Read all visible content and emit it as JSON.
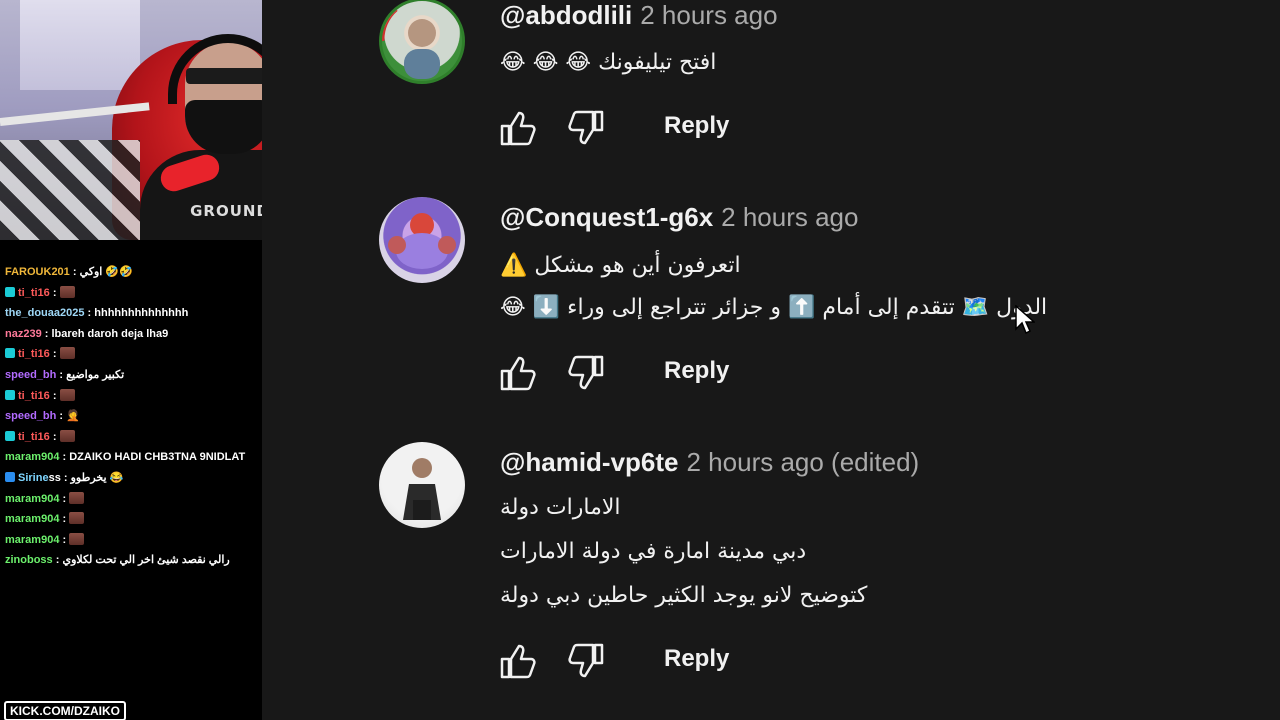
{
  "chat": {
    "messages": [
      {
        "user": "FAROUK201",
        "color": "#f0b73a",
        "sep": " : ",
        "text": "اوكي 🤣🤣",
        "badge": "",
        "emote": false
      },
      {
        "user": "ti_ti16",
        "color": "#ff5a5a",
        "sep": " : ",
        "text": "",
        "badge": "cyan",
        "emote": true
      },
      {
        "user": "the_douaa2025",
        "color": "#9fd8f7",
        "sep": " : ",
        "text": "hhhhhhhhhhhhhh",
        "badge": "",
        "emote": false
      },
      {
        "user": "naz239",
        "color": "#ff7a9a",
        "sep": " : ",
        "text": "lbareh daroh deja lha9",
        "badge": "",
        "emote": false
      },
      {
        "user": "ti_ti16",
        "color": "#ff5a5a",
        "sep": " : ",
        "text": "",
        "badge": "cyan",
        "emote": true
      },
      {
        "user": "speed_bh",
        "color": "#b26bff",
        "sep": " : ",
        "text": "تكبير مواضيع",
        "badge": "",
        "emote": false
      },
      {
        "user": "ti_ti16",
        "color": "#ff5a5a",
        "sep": " : ",
        "text": "",
        "badge": "cyan",
        "emote": true
      },
      {
        "user": "speed_bh",
        "color": "#b26bff",
        "sep": " : ",
        "text": "🤦",
        "badge": "",
        "emote": false
      },
      {
        "user": "ti_ti16",
        "color": "#ff5a5a",
        "sep": " : ",
        "text": "",
        "badge": "cyan",
        "emote": true
      },
      {
        "user": "maram904",
        "color": "#6cf06c",
        "sep": " : ",
        "text": "DZAIKO HADI CHB3TNA 9NIDLAT",
        "badge": "",
        "emote": false
      },
      {
        "user": "Sirine",
        "color": "#7fd6ff",
        "sep": "ss : ",
        "text": "يخرطوو 😂",
        "badge": "blue",
        "emote": false
      },
      {
        "user": "maram904",
        "color": "#6cf06c",
        "sep": " : ",
        "text": "",
        "badge": "",
        "emote": true
      },
      {
        "user": "maram904",
        "color": "#6cf06c",
        "sep": " : ",
        "text": "",
        "badge": "",
        "emote": true
      },
      {
        "user": "maram904",
        "color": "#6cf06c",
        "sep": " : ",
        "text": "",
        "badge": "",
        "emote": true
      },
      {
        "user": "zinoboss",
        "color": "#6cf06c",
        "sep": " : ",
        "text": "رالي نقصد شيئ اخر الي تحت لكلاوي",
        "badge": "",
        "emote": false
      }
    ],
    "brand": "KICK.COM/DZAIKO"
  },
  "webcam": {
    "shirt_text": "GROUND"
  },
  "comments": [
    {
      "author": "@abdodlili",
      "time": "2 hours ago",
      "lines": [
        "😂 😂 😂  افتح تيليفونك"
      ],
      "reply_label": "Reply"
    },
    {
      "author": "@Conquest1-g6x",
      "time": "2 hours ago",
      "lines": [
        "⚠️ اتعرفون أين هو مشكل",
        "😂 ⬇️ الدول 🗺️ تتقدم إلى أمام ⬆️ و جزائر تتراجع إلى وراء"
      ],
      "reply_label": "Reply"
    },
    {
      "author": "@hamid-vp6te",
      "time": "2 hours ago (edited)",
      "lines": [
        "الامارات دولة",
        "دبي مدينة امارة في دولة الامارات",
        "كتوضيح لانو يوجد الكثير حاطين دبي دولة"
      ],
      "reply_label": "Reply"
    }
  ],
  "icons": {
    "like": "thumbs-up-icon",
    "dislike": "thumbs-down-icon",
    "cursor": "mouse-cursor-icon"
  },
  "colors": {
    "panel_bg": "#181818",
    "text_primary": "#f1f1f1",
    "text_secondary": "#aaaaaa"
  }
}
